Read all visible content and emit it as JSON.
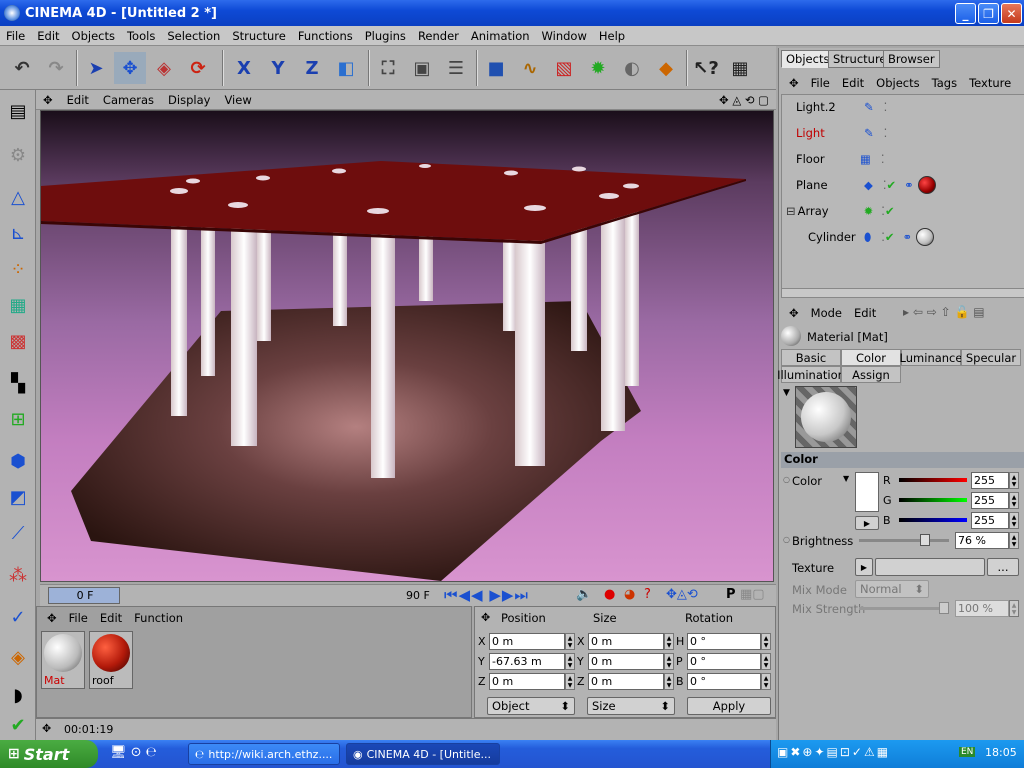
{
  "window": {
    "title": "CINEMA 4D - [Untitled 2 *]",
    "minimize": "_",
    "maximize": "❐",
    "close": "✕"
  },
  "menubar": [
    "File",
    "Edit",
    "Objects",
    "Tools",
    "Selection",
    "Structure",
    "Functions",
    "Plugins",
    "Render",
    "Animation",
    "Window",
    "Help"
  ],
  "toolbar": {
    "x_label": "X",
    "y_label": "Y",
    "z_label": "Z"
  },
  "viewport": {
    "menu": [
      "Edit",
      "Cameras",
      "Display",
      "View"
    ]
  },
  "timeline": {
    "current_frame": "0 F",
    "end_frame": "90 F"
  },
  "material_manager": {
    "menu": [
      "File",
      "Edit",
      "Function"
    ],
    "materials": [
      {
        "name": "Mat",
        "color": "#f2f2f2"
      },
      {
        "name": "roof",
        "color": "#b31a0a"
      }
    ]
  },
  "coordinates": {
    "headers": [
      "Position",
      "Size",
      "Rotation"
    ],
    "position": [
      {
        "axis": "X",
        "value": "0 m"
      },
      {
        "axis": "Y",
        "value": "-67.63 m"
      },
      {
        "axis": "Z",
        "value": "0 m"
      }
    ],
    "size": [
      {
        "axis": "X",
        "value": "0 m"
      },
      {
        "axis": "Y",
        "value": "0 m"
      },
      {
        "axis": "Z",
        "value": "0 m"
      }
    ],
    "rotation": [
      {
        "axis": "H",
        "value": "0 °"
      },
      {
        "axis": "P",
        "value": "0 °"
      },
      {
        "axis": "B",
        "value": "0 °"
      }
    ],
    "mode_select": "Object",
    "size_select": "Size",
    "apply_label": "Apply"
  },
  "status": {
    "time": "00:01:19"
  },
  "object_manager": {
    "tabs": [
      "Objects",
      "Structure",
      "Browser"
    ],
    "menu": [
      "File",
      "Edit",
      "Objects",
      "Tags",
      "Texture"
    ],
    "objects": [
      {
        "name": "Light.2",
        "color": "#000"
      },
      {
        "name": "Light",
        "color": "#c00000"
      },
      {
        "name": "Floor",
        "color": "#000"
      },
      {
        "name": "Plane",
        "color": "#000"
      },
      {
        "name": "Array",
        "color": "#000"
      },
      {
        "name": "Cylinder",
        "color": "#000"
      }
    ]
  },
  "attributes": {
    "menu": [
      "Mode",
      "Edit"
    ],
    "title": "Material [Mat]",
    "tabs": [
      "Basic",
      "Color",
      "Luminance",
      "Specular",
      "Illumination",
      "Assign"
    ],
    "section": "Color",
    "color_label": "Color",
    "r_label": "R",
    "g_label": "G",
    "b_label": "B",
    "r": "255",
    "g": "255",
    "b": "255",
    "brightness_label": "Brightness",
    "brightness": "76 %",
    "brightness_fraction": 0.76,
    "texture_label": "Texture",
    "texture_btn": "...",
    "mix_mode_label": "Mix Mode",
    "mix_mode": "Normal",
    "mix_strength_label": "Mix Strength",
    "mix_strength": "100 %"
  },
  "taskbar": {
    "start": "Start",
    "tasks": [
      {
        "label": "http://wiki.arch.ethz...."
      },
      {
        "label": "CINEMA 4D - [Untitle..."
      }
    ],
    "tray_lang": "EN",
    "clock": "18:05"
  }
}
